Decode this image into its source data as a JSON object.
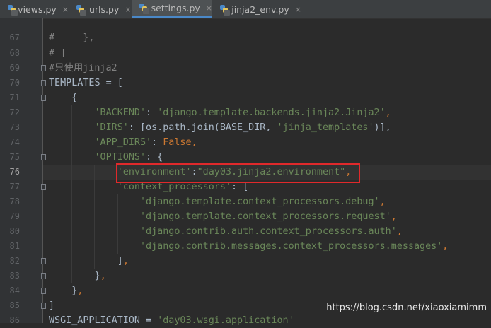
{
  "tabs": [
    {
      "label": "views.py",
      "close": "×",
      "active": false
    },
    {
      "label": "urls.py",
      "close": "×",
      "active": false
    },
    {
      "label": "settings.py",
      "close": "×",
      "active": true
    },
    {
      "label": "jinja2_env.py",
      "close": "×",
      "active": false
    }
  ],
  "lines": [
    {
      "num": "67",
      "text": "#     },"
    },
    {
      "num": "68",
      "text": "# ]"
    },
    {
      "num": "69",
      "text": "#只使用jinja2"
    },
    {
      "num": "70",
      "text": "TEMPLATES = ["
    },
    {
      "num": "71",
      "text": "    {"
    },
    {
      "num": "72",
      "p1": "        ",
      "s1": "'BACKEND'",
      "p2": ": ",
      "s2": "'django.template.backends.jinja2.Jinja2'",
      "p3": ","
    },
    {
      "num": "73",
      "p1": "        ",
      "s1": "'DIRS'",
      "p2": ": [os.path.join(BASE_DIR, ",
      "s2": "'jinja_templates'",
      "p3": ")],"
    },
    {
      "num": "74",
      "p1": "        ",
      "s1": "'APP_DIRS'",
      "p2": ": ",
      "k1": "False",
      "p3": ","
    },
    {
      "num": "75",
      "p1": "        ",
      "s1": "'OPTIONS'",
      "p2": ": {"
    },
    {
      "num": "76",
      "p1": "            ",
      "s1": "'environment'",
      "p2": ":",
      "s2": "\"day03.jinja2.environment\"",
      "k1": ","
    },
    {
      "num": "77",
      "p1": "            ",
      "s1": "'context_processors'",
      "p2": ": ["
    },
    {
      "num": "78",
      "p1": "                ",
      "s1": "'django.template.context_processors.debug'",
      "k1": ","
    },
    {
      "num": "79",
      "p1": "                ",
      "s1": "'django.template.context_processors.request'",
      "k1": ","
    },
    {
      "num": "80",
      "p1": "                ",
      "s1": "'django.contrib.auth.context_processors.auth'",
      "k1": ","
    },
    {
      "num": "81",
      "p1": "                ",
      "s1": "'django.contrib.messages.context_processors.messages'",
      "k1": ","
    },
    {
      "num": "82",
      "p1": "            ",
      "p2": "]",
      "k1": ","
    },
    {
      "num": "83",
      "p1": "        ",
      "p2": "}",
      "k1": ","
    },
    {
      "num": "84",
      "p1": "    ",
      "p2": "}",
      "k1": ","
    },
    {
      "num": "85",
      "text": "]"
    },
    {
      "num": "86",
      "p1": "WSGI_APPLICATION = ",
      "s1": "'day03.wsgi.application'"
    }
  ],
  "watermark": "https://blog.csdn.net/xiaoxiamimm",
  "colors": {
    "background": "#2b2b2b",
    "gutter": "#313335",
    "string": "#6a8759",
    "keyword": "#cc7832",
    "comment": "#808080",
    "highlight_box": "#e0292b",
    "active_tab_underline": "#4a88c7"
  },
  "icons": {
    "tab_file": "python-file-icon",
    "gutter_hint": "lightbulb-icon"
  }
}
